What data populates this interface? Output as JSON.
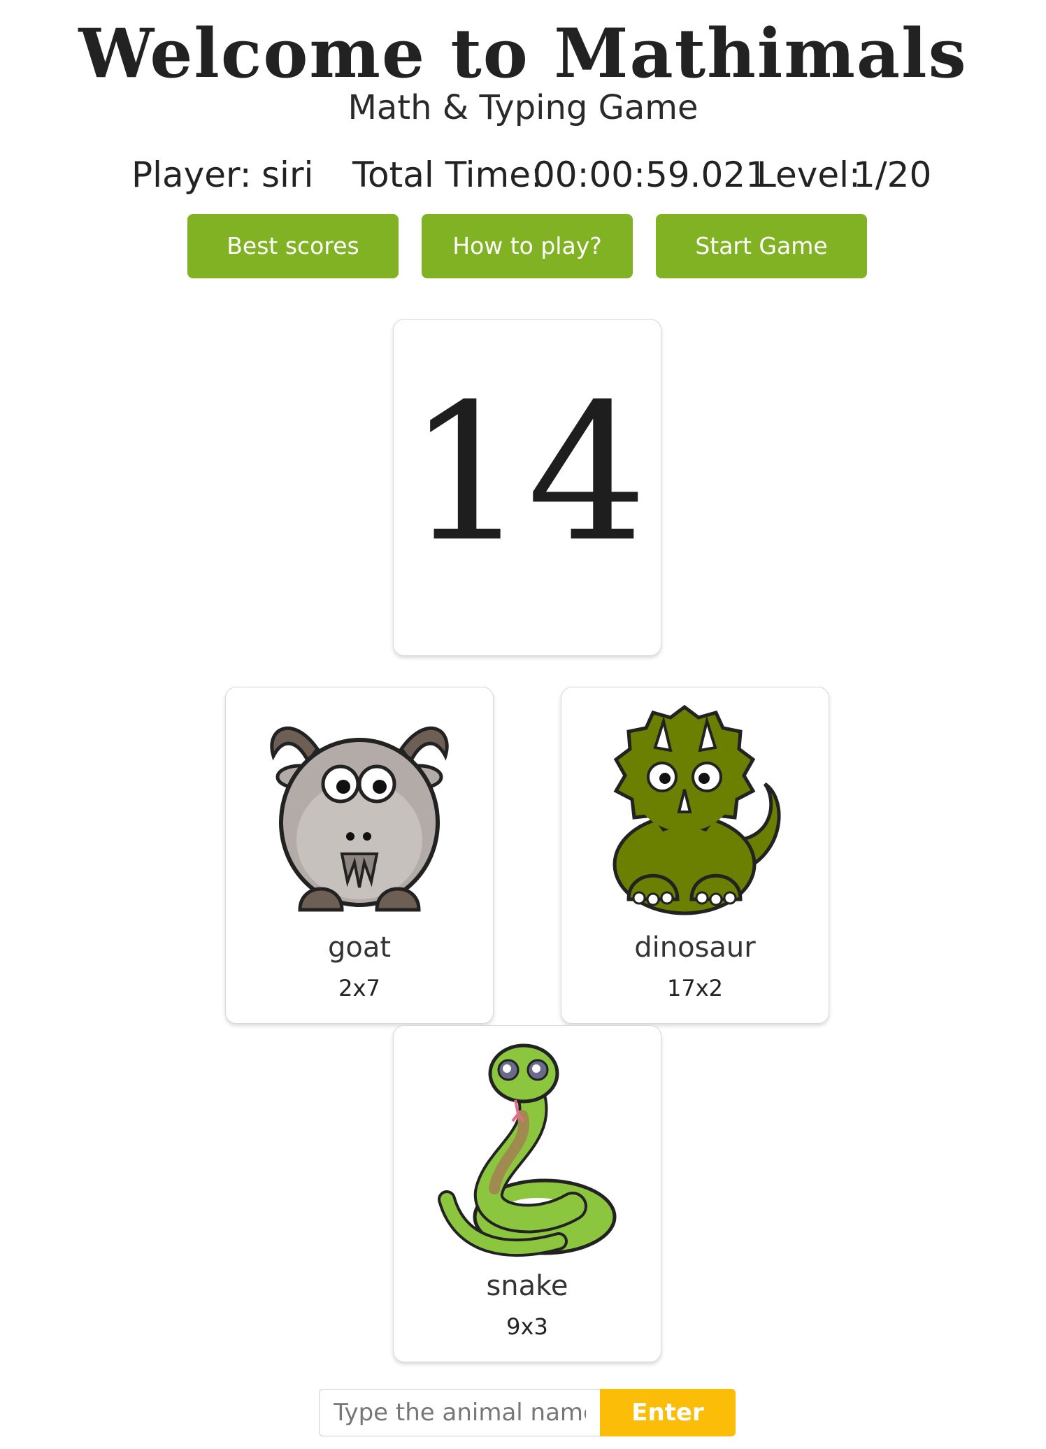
{
  "header": {
    "title": "Welcome to Mathimals",
    "subtitle": "Math & Typing Game"
  },
  "stats": {
    "player_label": "Player:",
    "player_name": "siri",
    "time_label": "Total Time:",
    "time_value": "00:00:59.021",
    "level_label": "Level:",
    "level_value": "1/20"
  },
  "buttons": {
    "best_scores": "Best scores",
    "how_to_play": "How to play?",
    "start_game": "Start Game"
  },
  "target": {
    "number": "14"
  },
  "animals": [
    {
      "name": "goat",
      "equation": "2x7",
      "icon": "goat-icon"
    },
    {
      "name": "dinosaur",
      "equation": "17x2",
      "icon": "dinosaur-icon"
    },
    {
      "name": "snake",
      "equation": "9x3",
      "icon": "snake-icon"
    }
  ],
  "answer": {
    "placeholder": "Type the animal name",
    "value": "",
    "enter_label": "Enter"
  },
  "colors": {
    "button_green": "#80b224",
    "enter_yellow": "#fbbd08",
    "dinosaur_green": "#6b7f00",
    "snake_green": "#8cc63f",
    "goat_gray": "#b3aba8"
  }
}
